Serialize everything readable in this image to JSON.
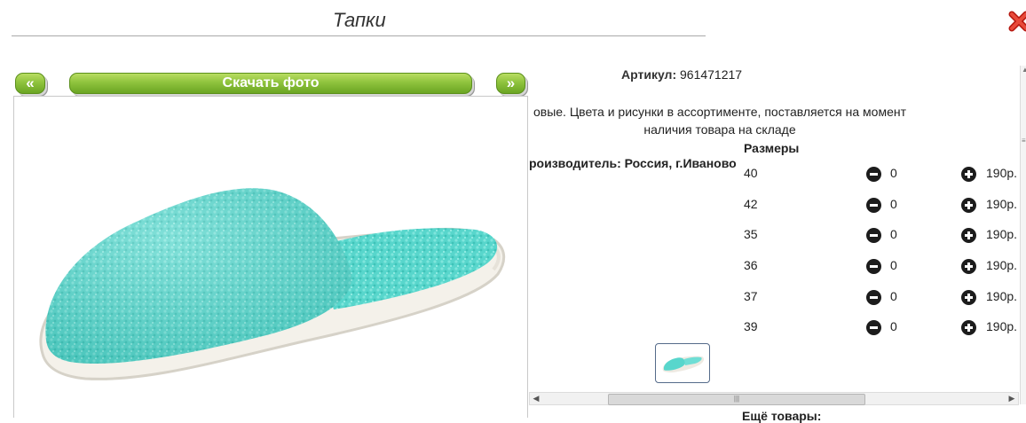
{
  "dialog": {
    "title": "Тапки",
    "close_icon": "close-x-icon",
    "accent_red": "#d9261c"
  },
  "gallery": {
    "prev_label": "«",
    "download_label": "Скачать фото",
    "next_label": "»",
    "button_color": "#8fc33d",
    "photo": "turquoise-slipper-photo"
  },
  "product": {
    "artikul_label": "Артикул:",
    "artikul_value": "961471217",
    "description_line1": "овые. Цвета и рисунки в ассортименте, поставляется на момент",
    "description_line2": "наличия товара на складе",
    "producer": "роизводитель: Россия, г.Иваново"
  },
  "sizes": {
    "header": "Размеры",
    "rows": [
      {
        "size": "40",
        "qty": "0",
        "price": "190р."
      },
      {
        "size": "42",
        "qty": "0",
        "price": "190р."
      },
      {
        "size": "35",
        "qty": "0",
        "price": "190р."
      },
      {
        "size": "36",
        "qty": "0",
        "price": "190р."
      },
      {
        "size": "37",
        "qty": "0",
        "price": "190р."
      },
      {
        "size": "39",
        "qty": "0",
        "price": "190р."
      }
    ]
  },
  "footer": {
    "more_label": "Ещё товары:"
  }
}
